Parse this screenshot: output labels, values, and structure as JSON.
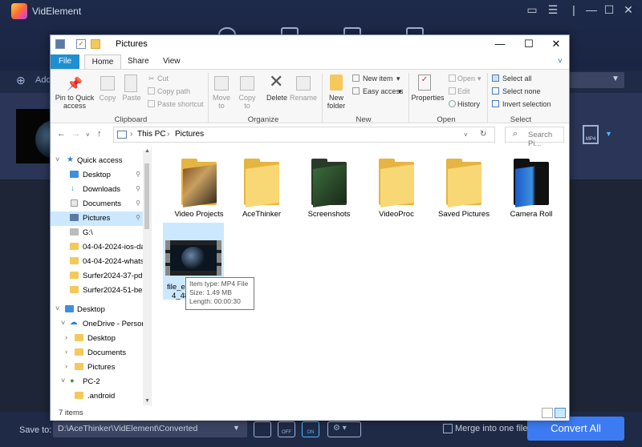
{
  "app": {
    "title": "VidElement",
    "add_label": "Add",
    "format_badge": "MP4",
    "save_to_label": "Save to:",
    "save_path": "D:\\AceThinker\\VidElement\\Converted",
    "merge_label": "Merge into one file",
    "convert_button": "Convert All",
    "bottom_icon_labels": [
      "OFF",
      "ON"
    ],
    "accent_color": "#3d7bf3"
  },
  "explorer": {
    "title": "Pictures",
    "window_controls": [
      "—",
      "☐",
      "✕"
    ],
    "tabs": [
      "File",
      "Home",
      "Share",
      "View"
    ],
    "ribbon": {
      "clipboard": {
        "pin": "Pin to Quick access",
        "copy": "Copy",
        "paste": "Paste",
        "cut": "Cut",
        "copy_path": "Copy path",
        "paste_shortcut": "Paste shortcut",
        "group": "Clipboard"
      },
      "organize": {
        "move_to": "Move to",
        "copy_to": "Copy to",
        "delete": "Delete",
        "rename": "Rename",
        "group": "Organize"
      },
      "new": {
        "new_folder": "New folder",
        "new_item": "New item",
        "easy_access": "Easy access",
        "group": "New"
      },
      "open": {
        "properties": "Properties",
        "open": "Open",
        "edit": "Edit",
        "history": "History",
        "group": "Open"
      },
      "select": {
        "select_all": "Select all",
        "select_none": "Select none",
        "invert": "Invert selection",
        "group": "Select"
      }
    },
    "address": {
      "crumbs": [
        "This PC",
        "Pictures"
      ],
      "search_placeholder": "Search Pi..."
    },
    "nav": [
      {
        "label": "Quick access"
      },
      {
        "label": "Desktop"
      },
      {
        "label": "Downloads"
      },
      {
        "label": "Documents"
      },
      {
        "label": "Pictures"
      },
      {
        "label": "G:\\"
      },
      {
        "label": "04-04-2024-ios-dat"
      },
      {
        "label": "04-04-2024-whatsa"
      },
      {
        "label": "Surfer2024-37-pdf-"
      },
      {
        "label": "Surfer2024-51-best"
      },
      {
        "label": "Desktop"
      },
      {
        "label": "OneDrive - Persona"
      },
      {
        "label": "Desktop"
      },
      {
        "label": "Documents"
      },
      {
        "label": "Pictures"
      },
      {
        "label": "PC-2"
      },
      {
        "label": ".android"
      }
    ],
    "folders": [
      "Video Projects",
      "AceThinker",
      "Screenshots",
      "VideoProc",
      "Saved Pictures",
      "Camera Roll"
    ],
    "video_file": {
      "label_1": "file_ex",
      "label_2": "4_48"
    },
    "tooltip": {
      "type": "Item type: MP4 File",
      "size": "Size: 1.49 MB",
      "length": "Length: 00:00:30"
    },
    "status": "7 items"
  }
}
